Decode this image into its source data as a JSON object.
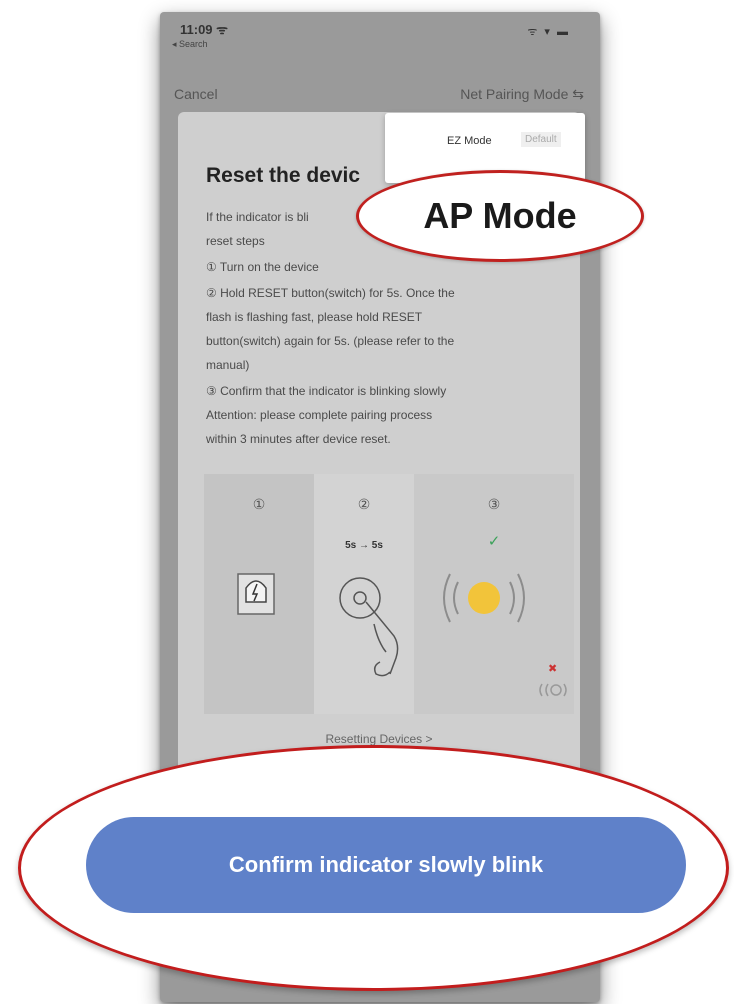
{
  "status_bar": {
    "time": "11:09 ᯤ",
    "back_app": "◂ Search",
    "icons": "ᯤ ▾ ▬"
  },
  "nav": {
    "cancel": "Cancel",
    "pairing_mode": "Net Pairing Mode ⇆"
  },
  "card": {
    "title": "Reset the devic",
    "lines": [
      "If the indicator is bli",
      "reset steps",
      "① Turn on the device",
      "② Hold RESET button(switch) for 5s. Once the",
      "flash is flashing fast, please hold RESET",
      "button(switch) again for 5s. (please refer to the",
      "manual)",
      "③ Confirm that the indicator is blinking slowly",
      "Attention: please complete pairing process",
      "within 3 minutes after device reset."
    ],
    "illustration": {
      "step_numbers": [
        "①",
        "②",
        "③"
      ],
      "timing": "5s → 5s",
      "check": "✓",
      "cross": "✖"
    },
    "resetting_link": "Resetting Devices >"
  },
  "dropdown": {
    "ez_mode": "EZ Mode",
    "default_tag": "Default",
    "ap_mode": "AP Mode"
  },
  "confirm_button": {
    "label": "Confirm indicator slowly blink"
  },
  "colors": {
    "button": "#5f81c9",
    "highlight_ring": "#c21d1d",
    "check": "#3ca25a",
    "indicator_light": "#f2c43a"
  }
}
